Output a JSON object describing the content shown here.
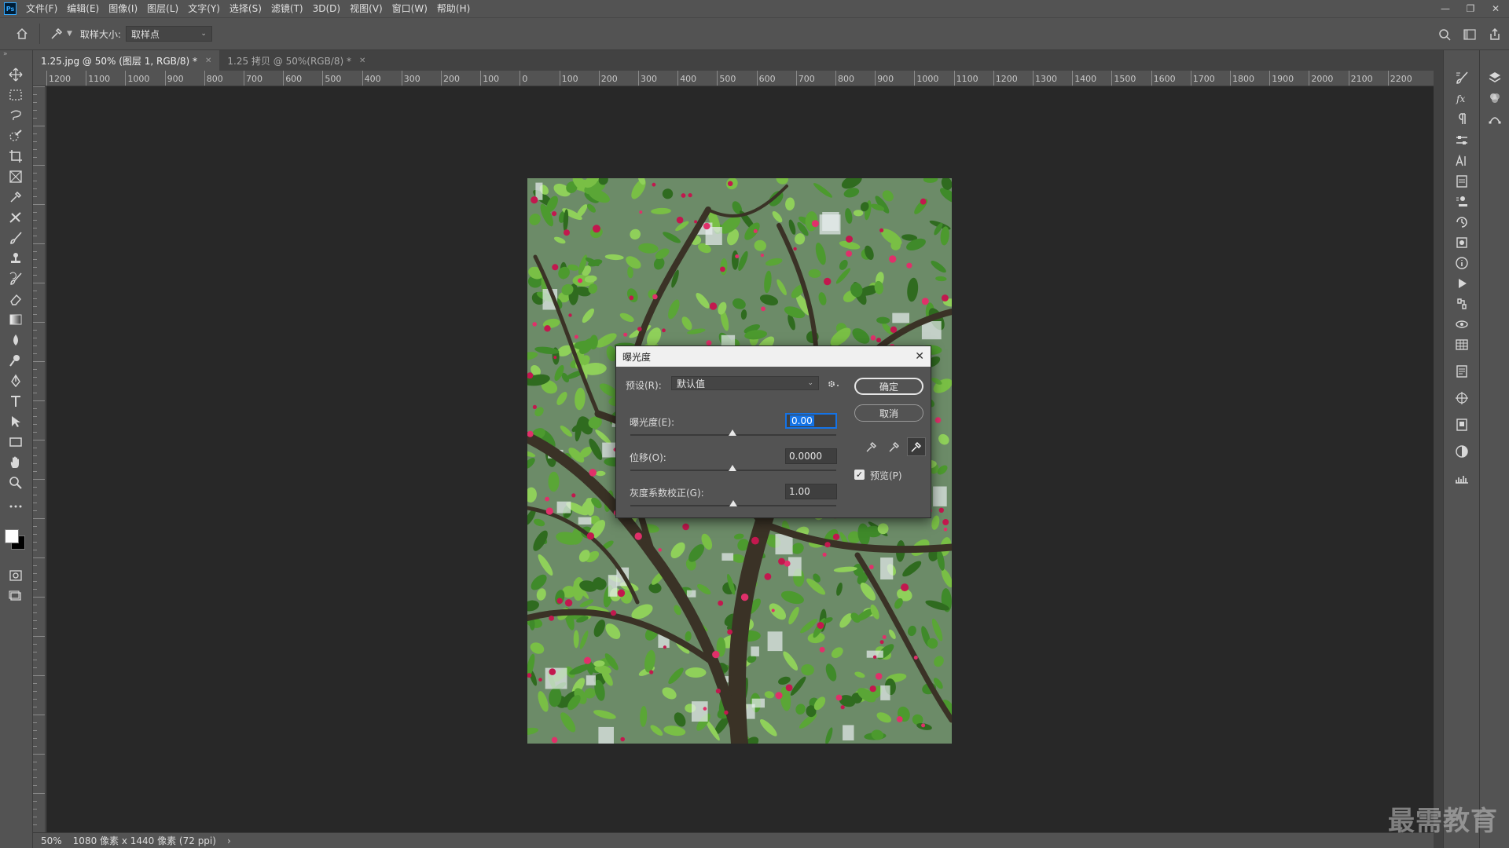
{
  "menu": {
    "logo": "Ps",
    "items": [
      "文件(F)",
      "编辑(E)",
      "图像(I)",
      "图层(L)",
      "文字(Y)",
      "选择(S)",
      "滤镜(T)",
      "3D(D)",
      "视图(V)",
      "窗口(W)",
      "帮助(H)"
    ]
  },
  "options": {
    "sample_size_label": "取样大小:",
    "sample_size_value": "取样点"
  },
  "tabs": [
    {
      "label": "1.25.jpg @ 50% (图层 1, RGB/8) *",
      "active": true
    },
    {
      "label": "1.25 拷贝 @ 50%(RGB/8) *",
      "active": false
    }
  ],
  "ruler": {
    "labels": [
      "1200",
      "1100",
      "1000",
      "900",
      "800",
      "700",
      "600",
      "500",
      "400",
      "300",
      "200",
      "100",
      "0",
      "100",
      "200",
      "300",
      "400",
      "500",
      "600",
      "700",
      "800",
      "900",
      "1000",
      "1100",
      "1200",
      "1300",
      "1400",
      "1500",
      "1600",
      "1700",
      "1800",
      "1900",
      "2000",
      "2100",
      "2200"
    ]
  },
  "status": {
    "zoom": "50%",
    "doc_info": "1080 像素 x 1440 像素 (72 ppi)"
  },
  "dialog": {
    "title": "曝光度",
    "preset_label": "预设(R):",
    "preset_value": "默认值",
    "exposure_label": "曝光度(E):",
    "exposure_value": "0.00",
    "offset_label": "位移(O):",
    "offset_value": "0.0000",
    "gamma_label": "灰度系数校正(G):",
    "gamma_value": "1.00",
    "ok_label": "确定",
    "cancel_label": "取消",
    "preview_label": "预览(P)",
    "preview_checked": true
  },
  "watermark": "最需教育",
  "colors": {
    "accent": "#1473e6",
    "panel": "#535353",
    "canvas_bg": "#282828",
    "foreground": "#ffffff",
    "background": "#000000"
  }
}
